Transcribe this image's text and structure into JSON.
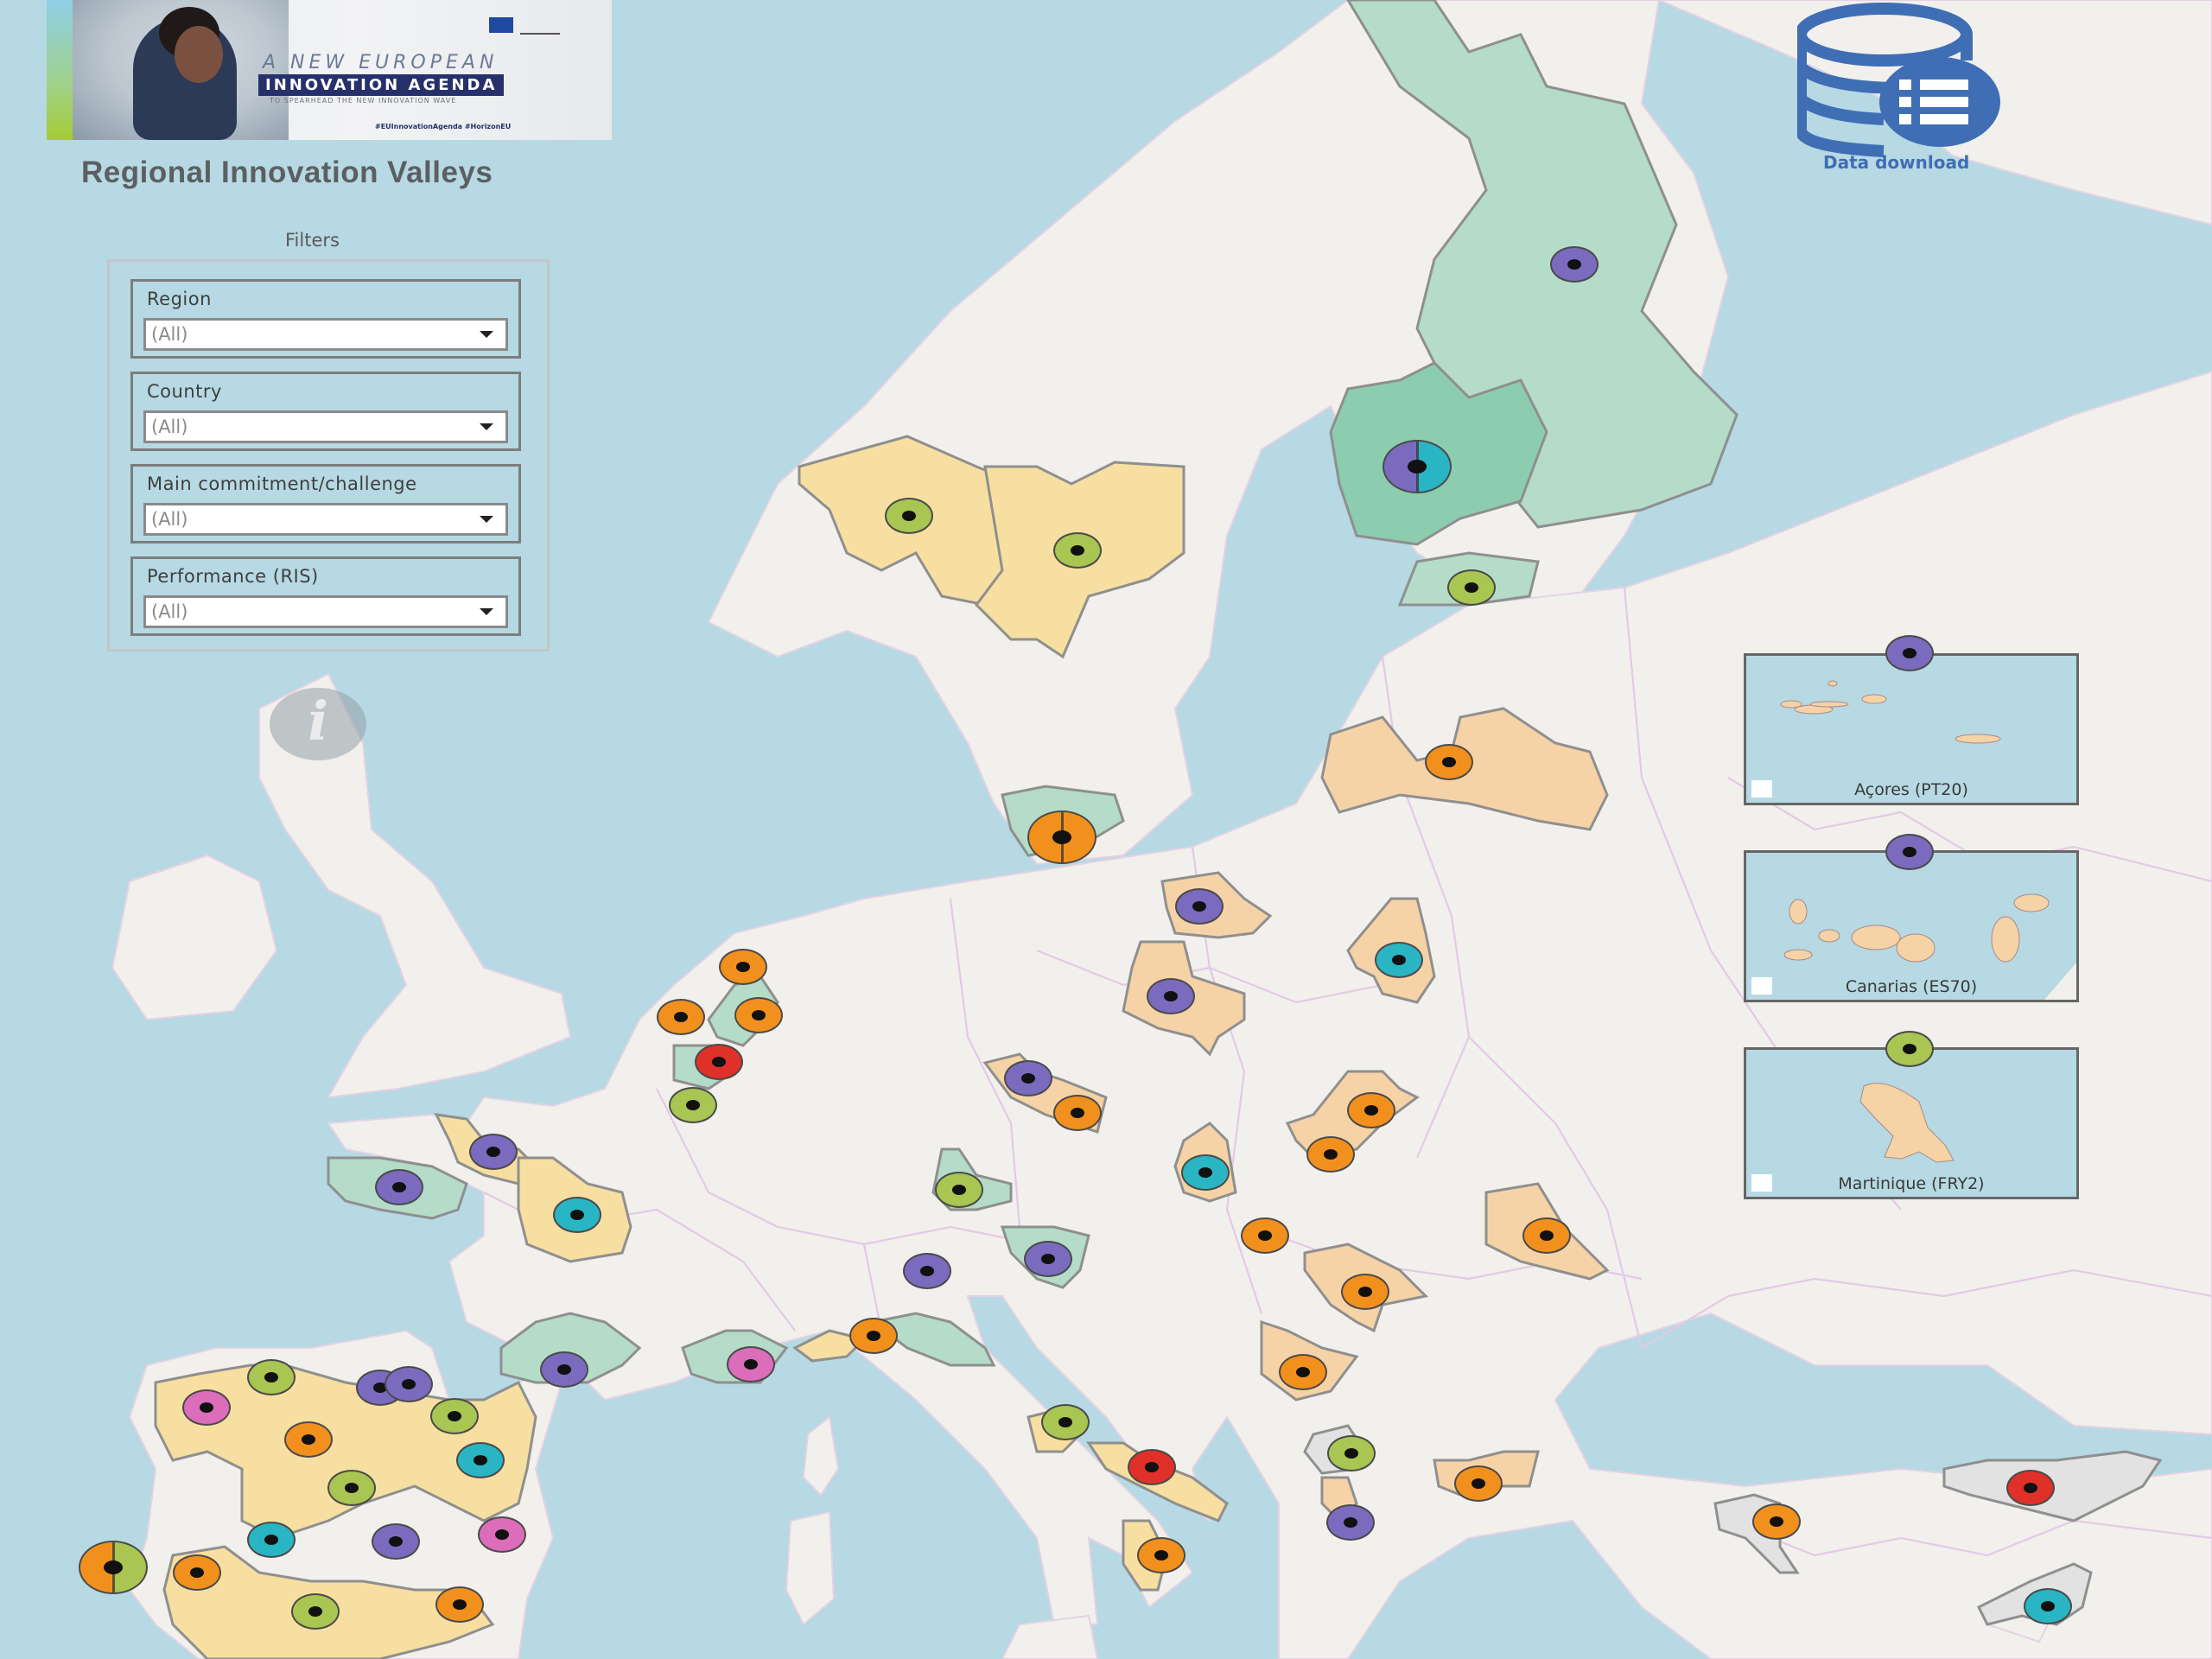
{
  "header": {
    "banner": {
      "line1": "A NEW EUROPEAN",
      "line2": "INNOVATION AGENDA",
      "line3": "TO SPEARHEAD THE NEW INNOVATION WAVE",
      "hashtags": "#EUInnovationAgenda   #HorizonEU"
    },
    "title": "Regional Innovation Valleys"
  },
  "filters": {
    "title": "Filters",
    "items": [
      {
        "label": "Region",
        "value": "(All)"
      },
      {
        "label": "Country",
        "value": "(All)"
      },
      {
        "label": "Main commitment/challenge",
        "value": "(All)"
      },
      {
        "label": "Performance (RIS)",
        "value": "(All)"
      }
    ]
  },
  "info": {
    "icon": "info-icon",
    "glyph": "i"
  },
  "data_download": {
    "label": "Data download",
    "icon": "database-list-icon"
  },
  "legend_colors": {
    "purple": "#7b6bbf",
    "teal": "#2ab5c4",
    "green": "#a9c552",
    "orange": "#f2901d",
    "red": "#e0302a",
    "pink": "#dc6dbb"
  },
  "region_fill_colors": {
    "green": "#b4dcc8",
    "deepgreen": "#8ccdb0",
    "yellow": "#f7dfa1",
    "peach": "#f6d3a6",
    "grey": "#e2e2e2"
  },
  "insets": [
    {
      "name": "Açores (PT20)",
      "marker": "purple"
    },
    {
      "name": "Canarias (ES70)",
      "marker": "purple"
    },
    {
      "name": "Martinique (FRY2)",
      "marker": "green"
    }
  ],
  "markers": [
    {
      "id": "fi-north",
      "colors": [
        "purple"
      ]
    },
    {
      "id": "fi-west",
      "colors": [
        "purple",
        "teal"
      ],
      "big": true
    },
    {
      "id": "fi-south",
      "colors": [
        "green"
      ]
    },
    {
      "id": "se-west",
      "colors": [
        "green"
      ]
    },
    {
      "id": "se-central",
      "colors": [
        "green"
      ]
    },
    {
      "id": "se-south",
      "colors": [
        "orange",
        "orange"
      ],
      "big": true
    },
    {
      "id": "lv",
      "colors": [
        "orange"
      ]
    },
    {
      "id": "pl-pomorskie",
      "colors": [
        "purple"
      ]
    },
    {
      "id": "pl-wielkopolskie",
      "colors": [
        "purple"
      ]
    },
    {
      "id": "pl-podlaskie",
      "colors": [
        "teal"
      ]
    },
    {
      "id": "nl-north",
      "colors": [
        "orange"
      ]
    },
    {
      "id": "nl-west",
      "colors": [
        "orange"
      ]
    },
    {
      "id": "nl-east",
      "colors": [
        "orange"
      ]
    },
    {
      "id": "be-flanders",
      "colors": [
        "red"
      ]
    },
    {
      "id": "be-wallonia",
      "colors": [
        "green"
      ]
    },
    {
      "id": "cz-west",
      "colors": [
        "purple"
      ]
    },
    {
      "id": "cz-south",
      "colors": [
        "orange"
      ]
    },
    {
      "id": "sk-east",
      "colors": [
        "orange"
      ]
    },
    {
      "id": "sk-central",
      "colors": [
        "orange"
      ]
    },
    {
      "id": "at-vienna",
      "colors": [
        "teal"
      ]
    },
    {
      "id": "hu-west",
      "colors": [
        "orange"
      ]
    },
    {
      "id": "ro-north-east",
      "colors": [
        "orange"
      ]
    },
    {
      "id": "ro-west",
      "colors": [
        "orange"
      ]
    },
    {
      "id": "rs-south",
      "colors": [
        "orange"
      ]
    },
    {
      "id": "fr-normandie",
      "colors": [
        "purple"
      ]
    },
    {
      "id": "fr-bretagne",
      "colors": [
        "purple"
      ]
    },
    {
      "id": "fr-centre",
      "colors": [
        "teal"
      ]
    },
    {
      "id": "de-bayern",
      "colors": [
        "green"
      ]
    },
    {
      "id": "ch-lombardia",
      "colors": [
        "purple"
      ]
    },
    {
      "id": "si",
      "colors": [
        "purple"
      ]
    },
    {
      "id": "fr-occitanie",
      "colors": [
        "purple"
      ]
    },
    {
      "id": "fr-paca",
      "colors": [
        "purple"
      ]
    },
    {
      "id": "it-liguria",
      "colors": [
        "pink"
      ]
    },
    {
      "id": "it-emilia",
      "colors": [
        "orange"
      ]
    },
    {
      "id": "it-abruzzo",
      "colors": [
        "green"
      ]
    },
    {
      "id": "it-puglia",
      "colors": [
        "red"
      ]
    },
    {
      "id": "it-calabria",
      "colors": [
        "orange"
      ]
    },
    {
      "id": "mk",
      "colors": [
        "green"
      ]
    },
    {
      "id": "gr-north",
      "colors": [
        "purple"
      ]
    },
    {
      "id": "gr-thrace",
      "colors": [
        "orange"
      ]
    },
    {
      "id": "tr-central",
      "colors": [
        "orange"
      ]
    },
    {
      "id": "tr-east",
      "colors": [
        "red"
      ]
    },
    {
      "id": "tr-south",
      "colors": [
        "teal"
      ]
    },
    {
      "id": "es-galicia",
      "colors": [
        "pink"
      ]
    },
    {
      "id": "es-asturias",
      "colors": [
        "green"
      ]
    },
    {
      "id": "es-pais-vasco",
      "colors": [
        "purple"
      ]
    },
    {
      "id": "es-navarra",
      "colors": [
        "green"
      ]
    },
    {
      "id": "es-castilla-leon",
      "colors": [
        "orange"
      ]
    },
    {
      "id": "es-aragon",
      "colors": [
        "teal"
      ]
    },
    {
      "id": "es-madrid",
      "colors": [
        "green"
      ]
    },
    {
      "id": "es-extremadura",
      "colors": [
        "teal"
      ]
    },
    {
      "id": "es-castilla-mancha",
      "colors": [
        "purple"
      ]
    },
    {
      "id": "es-valencia",
      "colors": [
        "pink"
      ]
    },
    {
      "id": "pt-norte",
      "colors": [
        "orange",
        "green"
      ],
      "big": true
    },
    {
      "id": "pt-centro",
      "colors": [
        "orange"
      ]
    },
    {
      "id": "es-andalucia",
      "colors": [
        "green"
      ]
    },
    {
      "id": "es-murcia",
      "colors": [
        "orange"
      ]
    }
  ]
}
